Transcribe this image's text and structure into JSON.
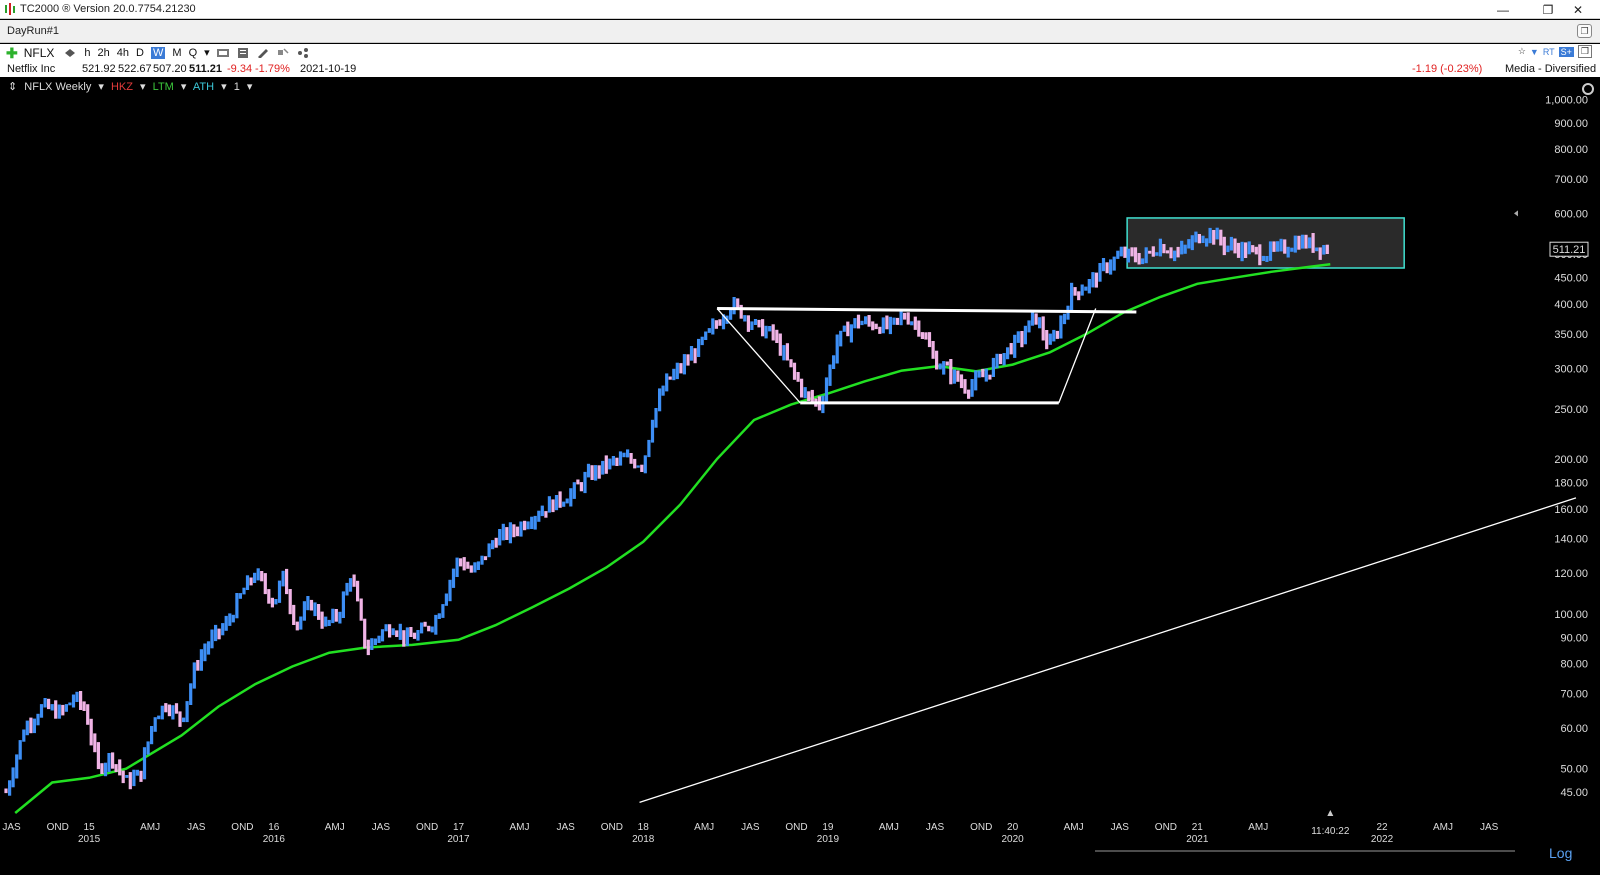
{
  "window": {
    "title": "TC2000 ® Version 20.0.7754.21230",
    "min_glyph": "—",
    "max_glyph": "❐",
    "close_glyph": "✕"
  },
  "layout": {
    "name": "DayRun#1"
  },
  "toolbar": {
    "symbol": "NFLX",
    "timeframes": [
      "h",
      "2h",
      "4h",
      "D",
      "W",
      "M",
      "Q"
    ],
    "selected_timeframe": "W",
    "right_badges": [
      "RT",
      "S+"
    ]
  },
  "quote": {
    "name": "Netflix Inc",
    "open": "521.92",
    "high": "522.67",
    "low": "507.20",
    "last": "511.21",
    "change": "-9.34",
    "change_pct": "-1.79%",
    "date": "2021-10-19",
    "after_change": "-1.19 (-0.23%)",
    "industry": "Media - Diversified"
  },
  "chart_header": {
    "title": "NFLX Weekly",
    "indicators": [
      "HKZ",
      "LTM",
      "ATH"
    ],
    "pane_number": "1"
  },
  "colors": {
    "up_bar": "#3d8ef5",
    "down_bar": "#f0b4e6",
    "moving_average": "#22e022",
    "trend_lines": "#ffffff",
    "range_box_border": "#40e0d0",
    "range_box_fill": "#2a2a2a"
  },
  "chart_data": {
    "type": "bar",
    "scale": "log",
    "price_axis": [
      "1,000.00",
      "900.00",
      "800.00",
      "700.00",
      "600.00",
      "500.00",
      "450.00",
      "400.00",
      "350.00",
      "300.00",
      "250.00",
      "200.00",
      "180.00",
      "160.00",
      "140.00",
      "120.00",
      "100.00",
      "90.00",
      "80.00",
      "70.00",
      "60.00",
      "50.00",
      "45.00"
    ],
    "ylim": [
      41,
      1100
    ],
    "last_price_tag": "511.21",
    "time_axis_months": [
      "JAS",
      "OND",
      "15",
      "AMJ",
      "JAS",
      "OND",
      "16",
      "AMJ",
      "JAS",
      "OND",
      "17",
      "AMJ",
      "JAS",
      "OND",
      "18",
      "AMJ",
      "JAS",
      "OND",
      "19",
      "AMJ",
      "JAS",
      "OND",
      "20",
      "AMJ",
      "JAS",
      "OND",
      "21",
      "AMJ",
      "22",
      "AMJ",
      "JAS"
    ],
    "time_axis_years": [
      "2015",
      "2016",
      "2017",
      "2018",
      "2019",
      "2020",
      "2021",
      "2022"
    ],
    "time_marker": "11:40:22",
    "price_points": [
      [
        2014.55,
        45
      ],
      [
        2014.65,
        60
      ],
      [
        2014.75,
        66
      ],
      [
        2014.85,
        64
      ],
      [
        2014.92,
        69
      ],
      [
        2014.98,
        65
      ],
      [
        2015.05,
        50
      ],
      [
        2015.12,
        53
      ],
      [
        2015.2,
        47
      ],
      [
        2015.28,
        49
      ],
      [
        2015.35,
        63
      ],
      [
        2015.42,
        67
      ],
      [
        2015.5,
        62
      ],
      [
        2015.58,
        80
      ],
      [
        2015.65,
        88
      ],
      [
        2015.75,
        96
      ],
      [
        2015.83,
        110
      ],
      [
        2015.9,
        120
      ],
      [
        2016.0,
        105
      ],
      [
        2016.05,
        118
      ],
      [
        2016.12,
        95
      ],
      [
        2016.2,
        105
      ],
      [
        2016.28,
        95
      ],
      [
        2016.35,
        100
      ],
      [
        2016.42,
        120
      ],
      [
        2016.5,
        85
      ],
      [
        2016.58,
        92
      ],
      [
        2016.65,
        95
      ],
      [
        2016.72,
        89
      ],
      [
        2016.8,
        92
      ],
      [
        2016.88,
        98
      ],
      [
        2016.95,
        115
      ],
      [
        2017.0,
        128
      ],
      [
        2017.08,
        120
      ],
      [
        2017.2,
        140
      ],
      [
        2017.3,
        145
      ],
      [
        2017.4,
        155
      ],
      [
        2017.5,
        163
      ],
      [
        2017.6,
        170
      ],
      [
        2017.7,
        185
      ],
      [
        2017.8,
        195
      ],
      [
        2017.9,
        200
      ],
      [
        2018.0,
        195
      ],
      [
        2018.05,
        240
      ],
      [
        2018.12,
        280
      ],
      [
        2018.2,
        300
      ],
      [
        2018.3,
        330
      ],
      [
        2018.38,
        360
      ],
      [
        2018.48,
        400
      ],
      [
        2018.55,
        380
      ],
      [
        2018.62,
        360
      ],
      [
        2018.7,
        350
      ],
      [
        2018.8,
        300
      ],
      [
        2018.88,
        265
      ],
      [
        2018.96,
        255
      ],
      [
        2019.05,
        340
      ],
      [
        2019.15,
        370
      ],
      [
        2019.25,
        365
      ],
      [
        2019.33,
        360
      ],
      [
        2019.42,
        380
      ],
      [
        2019.5,
        360
      ],
      [
        2019.58,
        310
      ],
      [
        2019.66,
        295
      ],
      [
        2019.75,
        275
      ],
      [
        2019.85,
        290
      ],
      [
        2019.95,
        320
      ],
      [
        2020.05,
        345
      ],
      [
        2020.12,
        380
      ],
      [
        2020.2,
        330
      ],
      [
        2020.25,
        360
      ],
      [
        2020.32,
        420
      ],
      [
        2020.42,
        440
      ],
      [
        2020.52,
        480
      ],
      [
        2020.6,
        500
      ],
      [
        2020.7,
        490
      ],
      [
        2020.8,
        520
      ],
      [
        2020.9,
        500
      ],
      [
        2021.0,
        540
      ],
      [
        2021.08,
        550
      ],
      [
        2021.15,
        520
      ],
      [
        2021.25,
        510
      ],
      [
        2021.35,
        500
      ],
      [
        2021.45,
        510
      ],
      [
        2021.55,
        530
      ],
      [
        2021.63,
        520
      ],
      [
        2021.72,
        511.21
      ]
    ],
    "moving_average": [
      [
        2014.6,
        41
      ],
      [
        2014.8,
        47
      ],
      [
        2015.0,
        48
      ],
      [
        2015.2,
        50
      ],
      [
        2015.5,
        58
      ],
      [
        2015.7,
        66
      ],
      [
        2015.9,
        73
      ],
      [
        2016.1,
        79
      ],
      [
        2016.3,
        84
      ],
      [
        2016.5,
        86
      ],
      [
        2016.75,
        87
      ],
      [
        2017.0,
        89
      ],
      [
        2017.2,
        95
      ],
      [
        2017.4,
        103
      ],
      [
        2017.6,
        112
      ],
      [
        2017.8,
        123
      ],
      [
        2018.0,
        138
      ],
      [
        2018.2,
        163
      ],
      [
        2018.4,
        200
      ],
      [
        2018.6,
        238
      ],
      [
        2018.8,
        255
      ],
      [
        2019.0,
        268
      ],
      [
        2019.2,
        283
      ],
      [
        2019.4,
        297
      ],
      [
        2019.6,
        303
      ],
      [
        2019.8,
        296
      ],
      [
        2020.0,
        305
      ],
      [
        2020.2,
        322
      ],
      [
        2020.4,
        350
      ],
      [
        2020.6,
        385
      ],
      [
        2020.8,
        413
      ],
      [
        2021.0,
        438
      ],
      [
        2021.2,
        450
      ],
      [
        2021.4,
        462
      ],
      [
        2021.6,
        472
      ],
      [
        2021.72,
        478
      ]
    ],
    "range_box": {
      "x0": 2020.62,
      "x1": 2022.12,
      "y_low": 470,
      "y_high": 588
    },
    "trend_lines": [
      {
        "x0": 2018.4,
        "y0": 392,
        "x1": 2020.67,
        "y1": 386
      },
      {
        "x0": 2018.85,
        "y0": 257,
        "x1": 2020.25,
        "y1": 257
      },
      {
        "x0": 2018.4,
        "y0": 392,
        "x1": 2018.85,
        "y1": 257
      },
      {
        "x0": 2020.25,
        "y0": 257,
        "x1": 2020.45,
        "y1": 392
      },
      {
        "x0": 2017.98,
        "y0": 43,
        "x1": 2023.05,
        "y1": 168
      }
    ]
  }
}
